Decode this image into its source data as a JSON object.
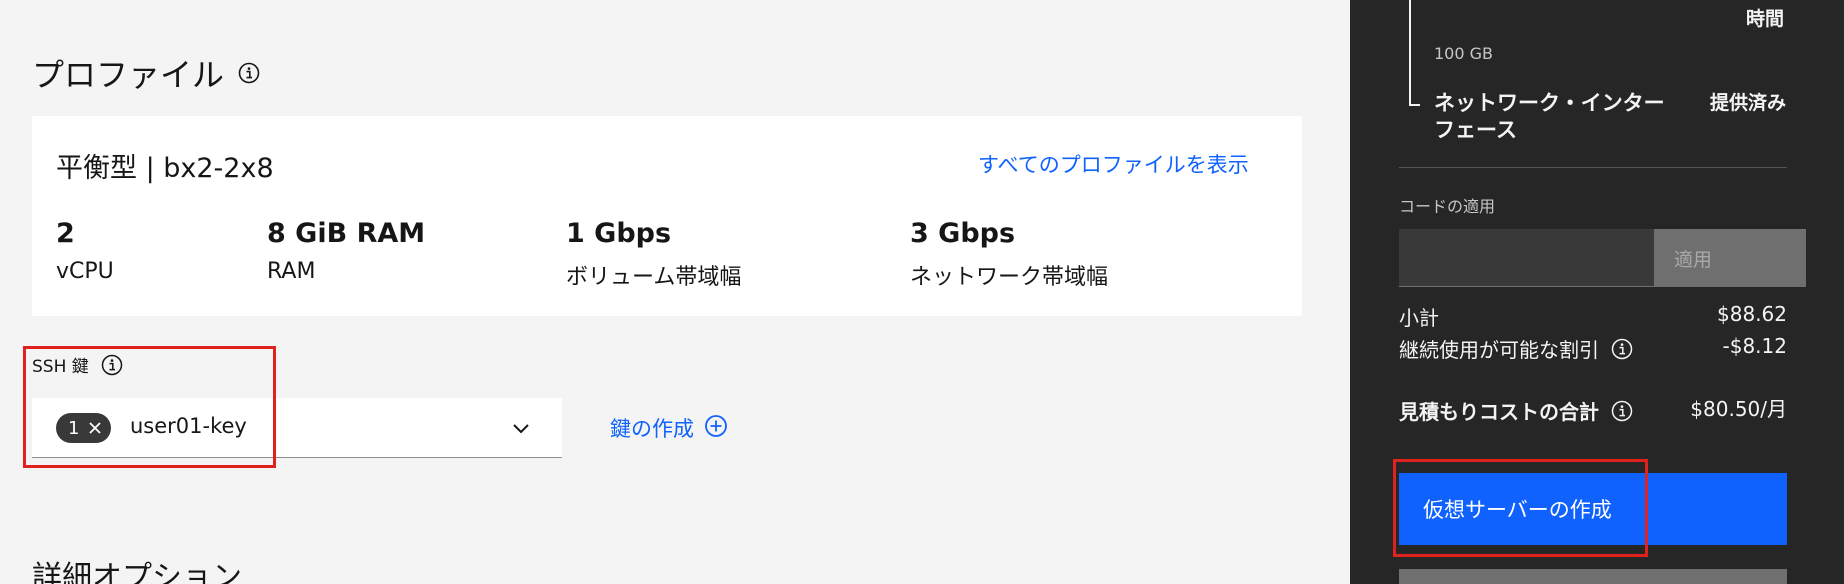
{
  "profile": {
    "title": "プロファイル",
    "name": "平衡型 | bx2-2x8",
    "view_all_link": "すべてのプロファイルを表示",
    "specs": [
      {
        "value": "2",
        "label": "vCPU"
      },
      {
        "value": "8 GiB RAM",
        "label": "RAM"
      },
      {
        "value": "1 Gbps",
        "label": "ボリューム帯域幅"
      },
      {
        "value": "3 Gbps",
        "label": "ネットワーク帯域幅"
      }
    ]
  },
  "ssh": {
    "label": "SSH 鍵",
    "tag_count": "1",
    "selected_value": "user01-key",
    "create_key_link": "鍵の作成"
  },
  "details": {
    "title": "詳細オプション"
  },
  "summary": {
    "hours_label": "時間",
    "storage_size": "100 GB",
    "network_interface_label": "ネットワーク・インターフェース",
    "network_interface_status": "提供済み",
    "code_label": "コードの適用",
    "code_input_value": "",
    "apply_button": "適用",
    "subtotal_label": "小計",
    "subtotal_value": "$88.62",
    "discount_label": "継続使用が可能な割引",
    "discount_value": "-$8.12",
    "total_label": "見積もりコストの合計",
    "total_value": "$80.50/月",
    "create_button": "仮想サーバーの作成"
  },
  "colors": {
    "accent": "#0f62fe",
    "side_panel_bg": "#262626",
    "highlight": "#e0221f"
  }
}
